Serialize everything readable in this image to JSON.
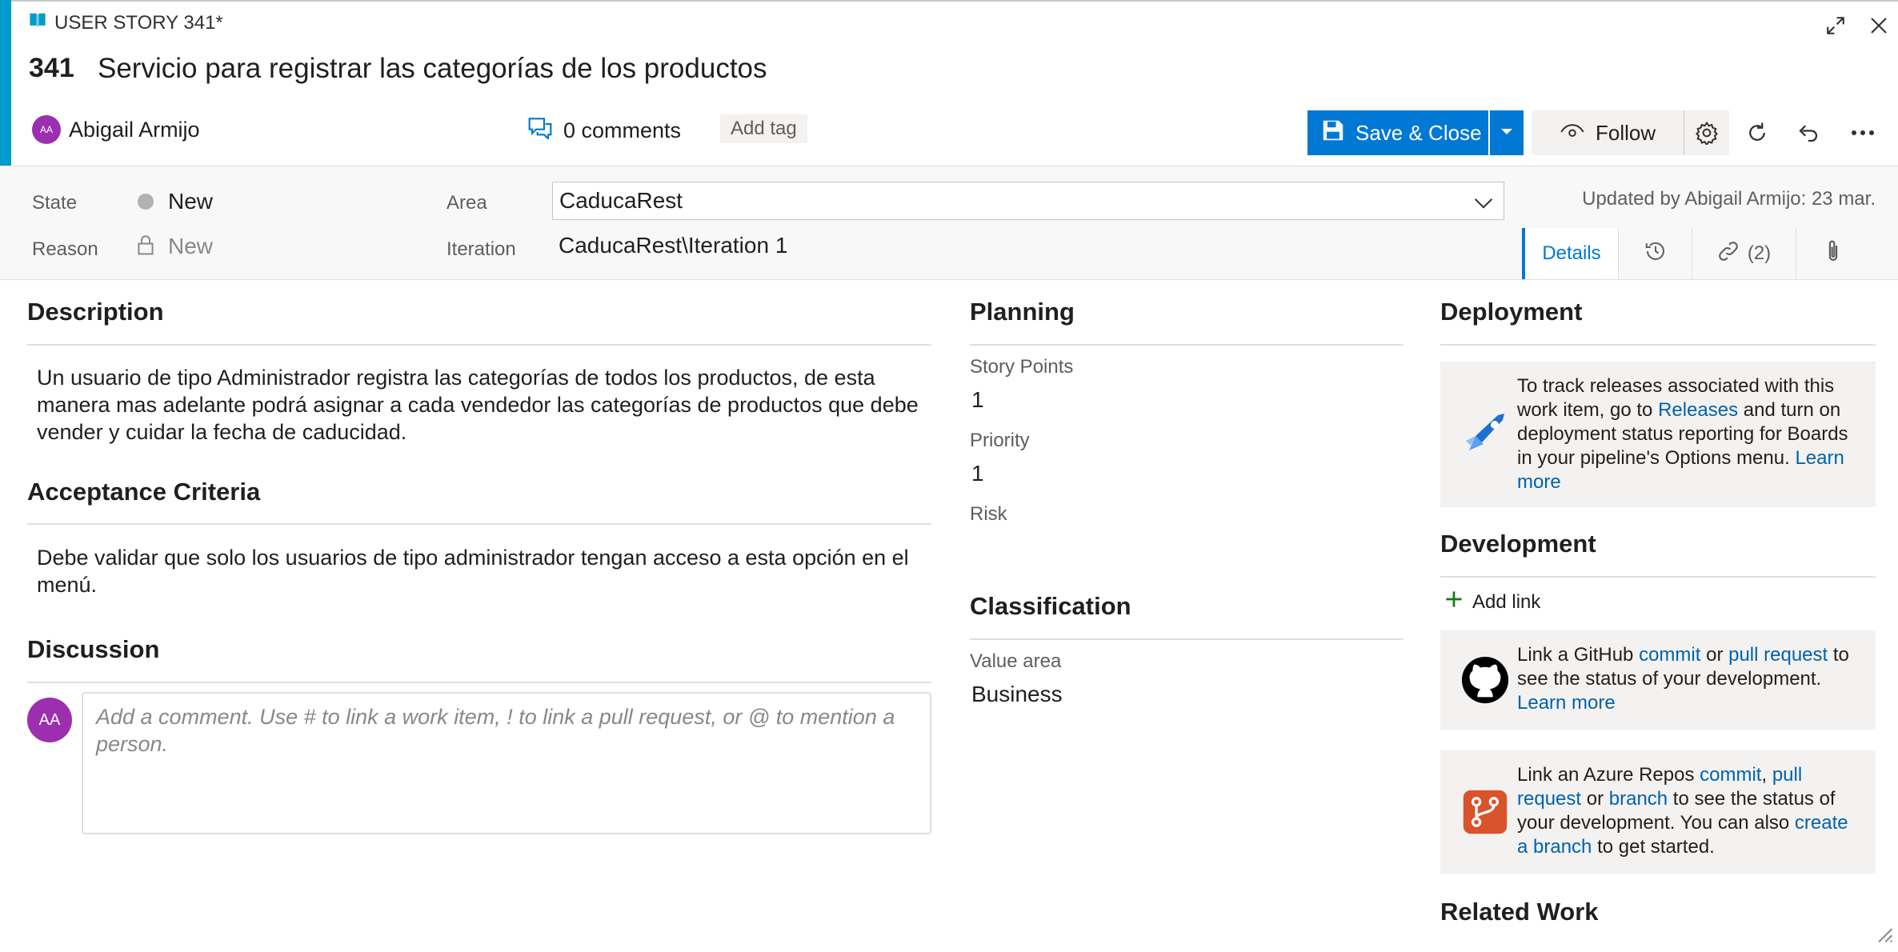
{
  "header": {
    "type_label": "USER STORY 341*",
    "id": "341",
    "title": "Servicio para registrar las categorías de los productos",
    "assignee": {
      "initials": "AA",
      "name": "Abigail Armijo"
    },
    "comments": "0 comments",
    "add_tag": "Add tag"
  },
  "toolbar": {
    "save_label": "Save & Close",
    "follow_label": "Follow"
  },
  "fields": {
    "state_label": "State",
    "state_value": "New",
    "reason_label": "Reason",
    "reason_value": "New",
    "area_label": "Area",
    "area_value": "CaducaRest",
    "iteration_label": "Iteration",
    "iteration_value": "CaducaRest\\Iteration 1",
    "updated": "Updated by Abigail Armijo: 23 mar."
  },
  "tabs": {
    "details": "Details",
    "links": "(2)"
  },
  "description": {
    "title": "Description",
    "text": "Un usuario de tipo Administrador registra las categorías de todos los productos,  de esta manera mas adelante podrá asignar a cada vendedor las categorías de productos que debe vender y cuidar la fecha de caducidad."
  },
  "acceptance": {
    "title": "Acceptance Criteria",
    "text": "Debe validar que solo los usuarios de tipo administrador tengan acceso a esta opción en el menú."
  },
  "discussion": {
    "title": "Discussion",
    "avatar_initials": "AA",
    "placeholder": "Add a comment. Use # to link a work item, ! to link a pull request, or @ to mention a person."
  },
  "planning": {
    "title": "Planning",
    "story_points_label": "Story Points",
    "story_points": "1",
    "priority_label": "Priority",
    "priority": "1",
    "risk_label": "Risk"
  },
  "classification": {
    "title": "Classification",
    "value_area_label": "Value area",
    "value_area": "Business"
  },
  "deployment": {
    "title": "Deployment",
    "t1": "To track releases associated with this work item, go to ",
    "releases": "Releases",
    "t2": " and turn on deployment status reporting for Boards in your pipeline's Options menu. ",
    "learn_more": "Learn more"
  },
  "development": {
    "title": "Development",
    "add_link": "Add link",
    "gh_t1": "Link a GitHub ",
    "gh_commit": "commit",
    "gh_t2": " or ",
    "gh_pr": "pull request",
    "gh_t3": " to see the status of your development. ",
    "gh_learn": "Learn more",
    "az_t1": "Link an Azure Repos ",
    "az_commit": "commit",
    "az_t2": ", ",
    "az_pr": "pull request",
    "az_t3": " or ",
    "az_branch": "branch",
    "az_t4": " to see the status of your development. You can also ",
    "az_create": "create a branch",
    "az_t5": " to get started."
  },
  "related_work": {
    "title": "Related Work"
  },
  "colors": {
    "accent": "#009ccc",
    "primary": "#0078d4",
    "avatar": "#9b2faf",
    "link": "#0062ad"
  }
}
